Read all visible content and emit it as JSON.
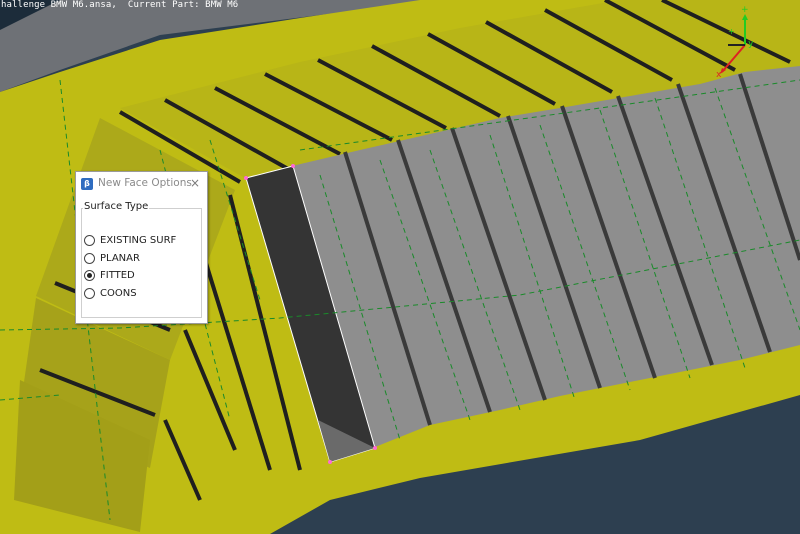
{
  "status_bar": {
    "text": "hallenge BMW M6.ansa,  Current Part: BMW M6"
  },
  "axes": {
    "x_label": "x",
    "y_label": "y"
  },
  "dialog": {
    "title": "New Face Options",
    "app_icon": "ansa-app-icon",
    "close_icon": "×",
    "group_title": "Surface Type",
    "options": [
      {
        "label": "EXISTING SURF",
        "checked": false
      },
      {
        "label": "PLANAR",
        "checked": false
      },
      {
        "label": "FITTED",
        "checked": true
      },
      {
        "label": "COONS",
        "checked": false
      }
    ]
  },
  "colors": {
    "background": "#2d3f50",
    "part_yellow": "#bfbc14",
    "face_gray": "#8e8e8e",
    "selected_face": "#343434",
    "edge_dash": "#1a8a2a",
    "selection_highlight": "#ff6ad5"
  }
}
